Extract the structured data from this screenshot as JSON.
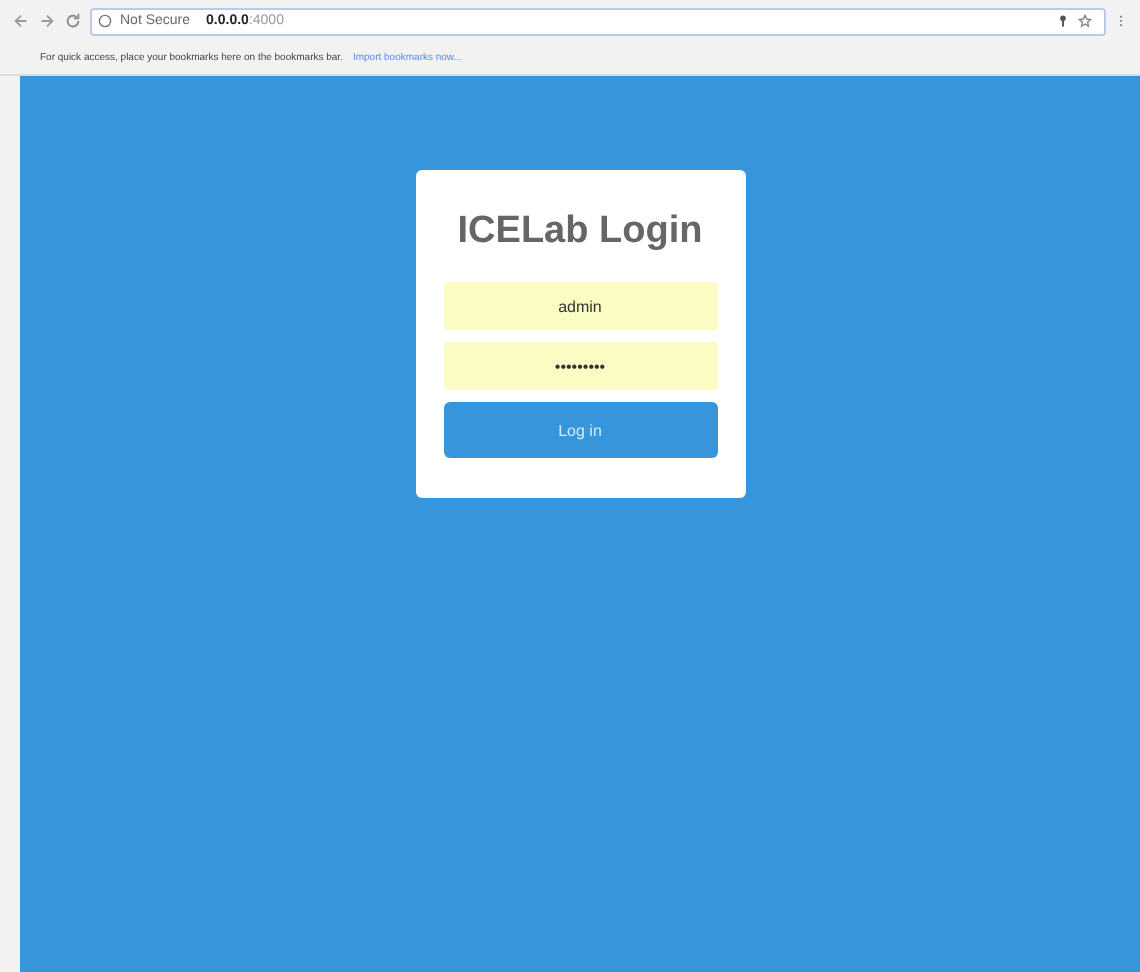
{
  "browser": {
    "security": "Not Secure",
    "address": "**0.0.0.0**:4000",
    "bookmarks_hint": "For quick access, place your bookmarks here on the bookmarks bar.",
    "bookmarks_link": "Import bookmarks now..."
  },
  "login": {
    "title": "ICELab Login",
    "username": "admin",
    "password": "•••••••••",
    "button": "Log in"
  }
}
